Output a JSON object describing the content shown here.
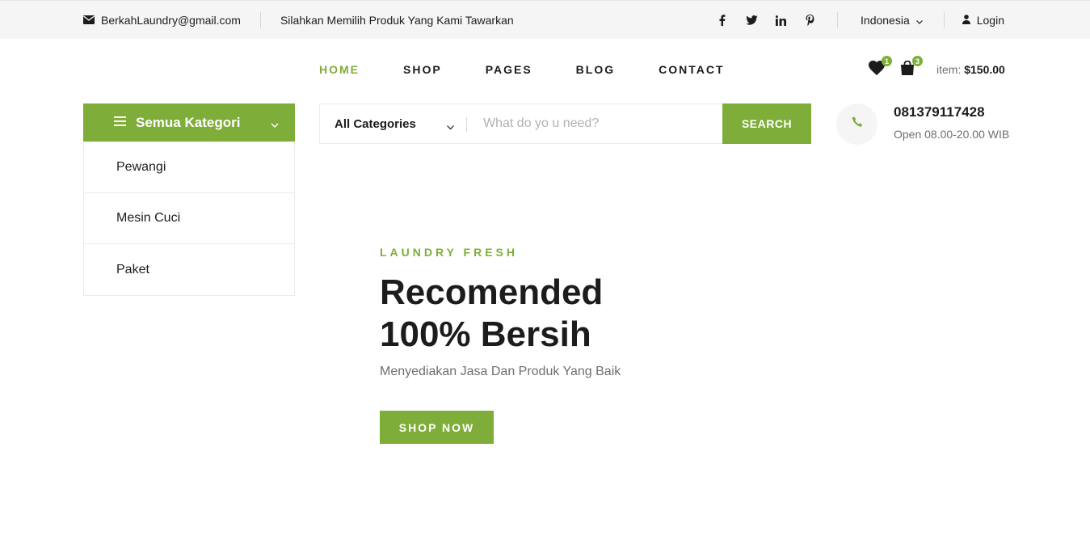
{
  "topbar": {
    "email": "BerkahLaundry@gmail.com",
    "tagline": "Silahkan Memilih Produk Yang Kami Tawarkan",
    "socials": [
      "facebook-icon",
      "twitter-icon",
      "linkedin-icon",
      "pinterest-icon"
    ],
    "language": "Indonesia",
    "login": "Login"
  },
  "nav": {
    "items": [
      {
        "label": "HOME",
        "active": true
      },
      {
        "label": "SHOP"
      },
      {
        "label": "PAGES"
      },
      {
        "label": "BLOG"
      },
      {
        "label": "CONTACT"
      }
    ]
  },
  "header": {
    "wishlist_count": "1",
    "cart_count": "3",
    "cart_label": "item:",
    "cart_total": "$150.00"
  },
  "categories": {
    "title": "Semua Kategori",
    "items": [
      "Pewangi",
      "Mesin Cuci",
      "Paket"
    ]
  },
  "search": {
    "category": "All Categories",
    "placeholder": "What do yo u need?",
    "button": "SEARCH"
  },
  "contact": {
    "phone": "081379117428",
    "hours": "Open 08.00-20.00 WIB"
  },
  "hero": {
    "kicker": "LAUNDRY FRESH",
    "title_line1": "Recomended",
    "title_line2": "100% Bersih",
    "subtitle": "Menyediakan Jasa Dan Produk Yang Baik",
    "button": "SHOP NOW"
  },
  "colors": {
    "accent": "#7fad39",
    "dark": "#1c1c1c",
    "muted": "#6f6f6f",
    "topbar_bg": "#f5f5f5"
  }
}
